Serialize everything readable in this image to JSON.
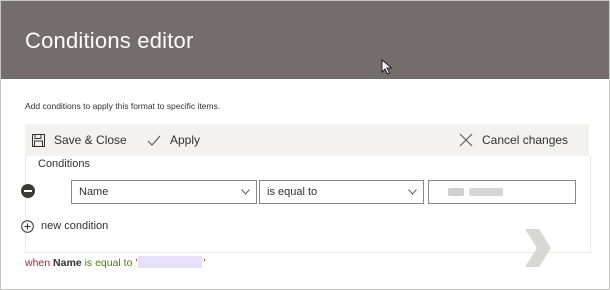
{
  "dialog": {
    "title": "Conditions editor",
    "description": "Add conditions to apply this format to specific items."
  },
  "command_bar": {
    "save_close_label": "Save & Close",
    "apply_label": "Apply",
    "cancel_label": "Cancel changes"
  },
  "conditions": {
    "legend": "Conditions",
    "rows": [
      {
        "field": "Name",
        "operator": "is equal to",
        "value_redacted": true
      }
    ],
    "new_condition_label": "new condition"
  },
  "summary": {
    "when": "when",
    "field": "Name",
    "operator": "is equal to",
    "quote_open": "'",
    "quote_close": "'"
  },
  "icons": {
    "save": "save-icon",
    "apply": "checkmark-icon",
    "cancel": "close-icon",
    "remove": "remove-circle-icon",
    "add": "add-circle-icon",
    "dropdown": "chevron-down-icon",
    "cursor": "mouse-cursor-icon"
  },
  "colors": {
    "header_background": "#736e6b",
    "command_bar_background": "#f3f2f1",
    "summary_keyword": "#a4262c",
    "summary_operator": "#498205",
    "redaction": "#e6e0f8"
  }
}
